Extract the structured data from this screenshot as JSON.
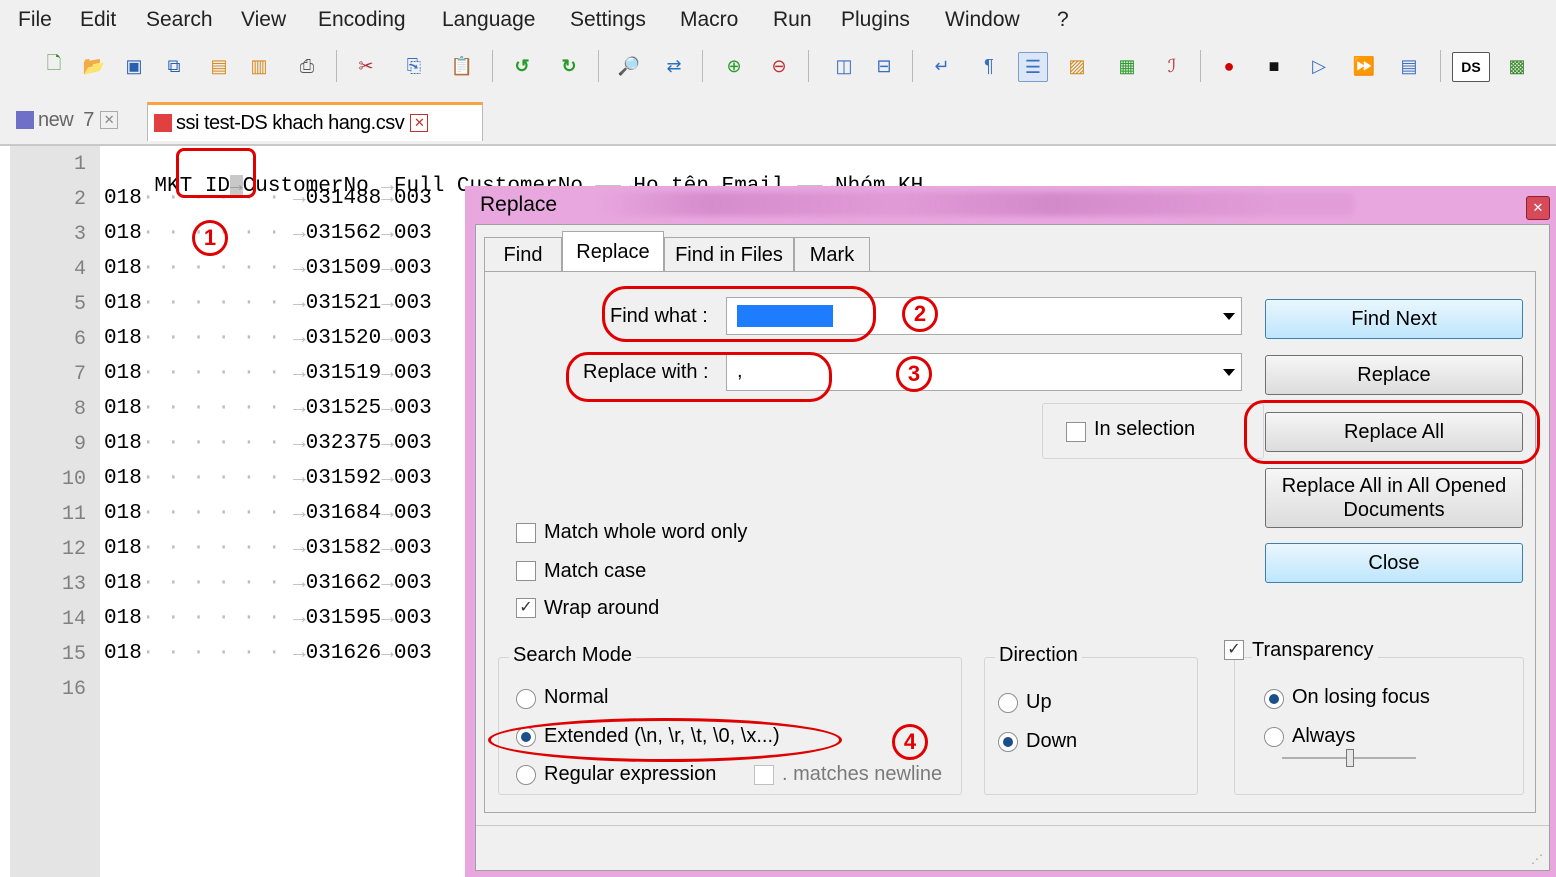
{
  "menu": [
    "File",
    "Edit",
    "Search",
    "View",
    "Encoding",
    "Language",
    "Settings",
    "Macro",
    "Run",
    "Plugins",
    "Window",
    "?"
  ],
  "toolbar_icons": [
    "new-file-icon",
    "open-file-icon",
    "save-icon",
    "save-all-icon",
    "close-icon",
    "close-all-icon",
    "print-icon",
    "cut-icon",
    "copy-icon",
    "paste-icon",
    "undo-icon",
    "redo-icon",
    "find-icon",
    "replace-icon",
    "zoom-in-icon",
    "zoom-out-icon",
    "sync-v-icon",
    "sync-h-icon",
    "wrap-icon",
    "show-all-chars-icon",
    "indent-guide-icon",
    "doc-map-icon",
    "function-list-icon",
    "folder-workspace-icon",
    "record-macro-icon",
    "stop-macro-icon",
    "play-macro-icon",
    "run-macro-multiple-icon",
    "save-macro-icon",
    "ds-icon",
    "plugin-icon"
  ],
  "tabs": [
    {
      "label": "new  7",
      "active": false
    },
    {
      "label": "ssi test-DS khach hang.csv",
      "active": true
    }
  ],
  "editor": {
    "line_numbers": [
      "1",
      "2",
      "3",
      "4",
      "5",
      "6",
      "7",
      "8",
      "9",
      "10",
      "11",
      "12",
      "13",
      "14",
      "15",
      "16"
    ],
    "header_line": {
      "c1": "MKT ID",
      "c2": "CustomerNo",
      "c3": "Full CustomerNo",
      "c4": "Họ tên",
      "c5": "Email",
      "c6": "Nhóm KH"
    },
    "rows": [
      {
        "id": "018",
        "no": "031488",
        "tail": "003"
      },
      {
        "id": "018",
        "no": "031562",
        "tail": "003"
      },
      {
        "id": "018",
        "no": "031509",
        "tail": "003"
      },
      {
        "id": "018",
        "no": "031521",
        "tail": "003"
      },
      {
        "id": "018",
        "no": "031520",
        "tail": "003"
      },
      {
        "id": "018",
        "no": "031519",
        "tail": "003"
      },
      {
        "id": "018",
        "no": "031525",
        "tail": "003"
      },
      {
        "id": "018",
        "no": "032375",
        "tail": "003"
      },
      {
        "id": "018",
        "no": "031592",
        "tail": "003"
      },
      {
        "id": "018",
        "no": "031684",
        "tail": "003"
      },
      {
        "id": "018",
        "no": "031582",
        "tail": "003"
      },
      {
        "id": "018",
        "no": "031662",
        "tail": "003"
      },
      {
        "id": "018",
        "no": "031595",
        "tail": "003"
      },
      {
        "id": "018",
        "no": "031626",
        "tail": "003"
      }
    ]
  },
  "dialog": {
    "title": "Replace",
    "tabs": [
      "Find",
      "Replace",
      "Find in Files",
      "Mark"
    ],
    "find_what_label": "Find what :",
    "replace_with_label": "Replace with :",
    "replace_with_value": ",",
    "in_selection_label": "In selection",
    "buttons": {
      "find_next": "Find Next",
      "replace": "Replace",
      "replace_all": "Replace All",
      "replace_all_opened": "Replace All in All Opened Documents",
      "close": "Close"
    },
    "options": {
      "match_whole_word": "Match whole word only",
      "match_case": "Match case",
      "wrap_around": "Wrap around"
    },
    "search_mode": {
      "title": "Search Mode",
      "normal": "Normal",
      "extended": "Extended (\\n, \\r, \\t, \\0, \\x...)",
      "regex": "Regular expression",
      "matches_newline": ". matches newline",
      "selected": "extended"
    },
    "direction": {
      "title": "Direction",
      "up": "Up",
      "down": "Down",
      "selected": "down"
    },
    "transparency": {
      "title": "Transparency",
      "on_losing_focus": "On losing focus",
      "always": "Always",
      "selected": "on_losing_focus"
    }
  },
  "annotations": [
    "1",
    "2",
    "3",
    "4"
  ],
  "colors": {
    "annotation": "#e00000",
    "dialog_frame": "#e9a7df",
    "selection": "#1e7cff"
  }
}
